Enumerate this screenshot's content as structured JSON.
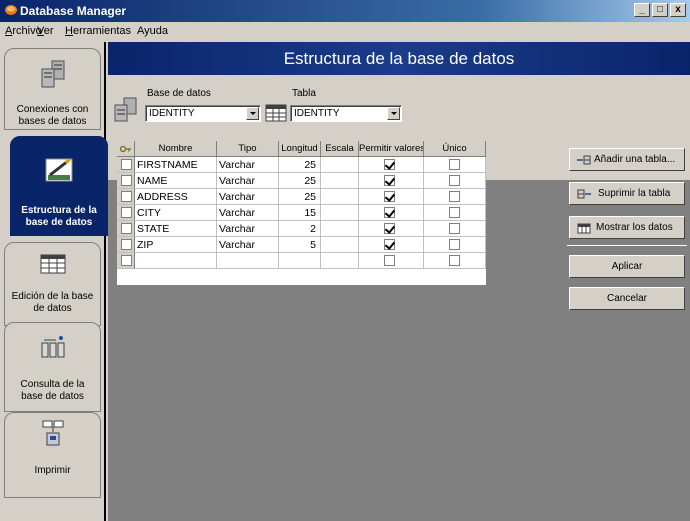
{
  "window": {
    "title": "Database Manager",
    "controls": [
      "_",
      "□",
      "x"
    ]
  },
  "menu": [
    {
      "label": "Archivo",
      "underline": "A"
    },
    {
      "label": "Ver",
      "underline": "V"
    },
    {
      "label": "Herramientas",
      "underline": "H"
    },
    {
      "label": "Ayuda",
      "underline": ""
    }
  ],
  "sidebar": {
    "items": [
      {
        "label_1": "Conexiones con",
        "label_2": "bases de datos",
        "icon": "database-connection-icon",
        "active": false
      },
      {
        "label_1": "Estructura de la",
        "label_2": "base de datos",
        "icon": "database-structure-icon",
        "active": true
      },
      {
        "label_1": "Edición de la base",
        "label_2": "de datos",
        "icon": "table-edit-icon",
        "active": false
      },
      {
        "label_1": "Consulta de la",
        "label_2": "base de datos",
        "icon": "query-icon",
        "active": false
      },
      {
        "label_1": "Imprimir",
        "label_2": "",
        "icon": "print-icon",
        "active": false
      }
    ]
  },
  "main": {
    "title": "Estructura de la base de datos",
    "database": {
      "label": "Base de datos",
      "value": "IDENTITY"
    },
    "table": {
      "label": "Tabla",
      "value": "IDENTITY"
    }
  },
  "grid": {
    "columns": [
      "",
      "Nombre",
      "Tipo",
      "Longitud",
      "Escala",
      "Permitir valores",
      "Único"
    ],
    "rows": [
      {
        "name": "FIRSTNAME",
        "type": "Varchar",
        "length": "25",
        "scale": "",
        "nullable": true,
        "unique": false
      },
      {
        "name": "NAME",
        "type": "Varchar",
        "length": "25",
        "scale": "",
        "nullable": true,
        "unique": false
      },
      {
        "name": "ADDRESS",
        "type": "Varchar",
        "length": "25",
        "scale": "",
        "nullable": true,
        "unique": false
      },
      {
        "name": "CITY",
        "type": "Varchar",
        "length": "15",
        "scale": "",
        "nullable": true,
        "unique": false
      },
      {
        "name": "STATE",
        "type": "Varchar",
        "length": "2",
        "scale": "",
        "nullable": true,
        "unique": false
      },
      {
        "name": "ZIP",
        "type": "Varchar",
        "length": "5",
        "scale": "",
        "nullable": true,
        "unique": false
      },
      {
        "name": "",
        "type": "",
        "length": "",
        "scale": "",
        "nullable": false,
        "unique": false
      }
    ]
  },
  "actions": {
    "add_table": "Añadir una tabla...",
    "delete_table": "Suprimir la tabla",
    "show_data": "Mostrar los datos",
    "apply": "Aplicar",
    "cancel": "Cancelar"
  },
  "colors": {
    "title_bar": "#0a246a",
    "header_band": "#0a246a",
    "workspace": "#808080",
    "face": "#d4d0c8"
  }
}
